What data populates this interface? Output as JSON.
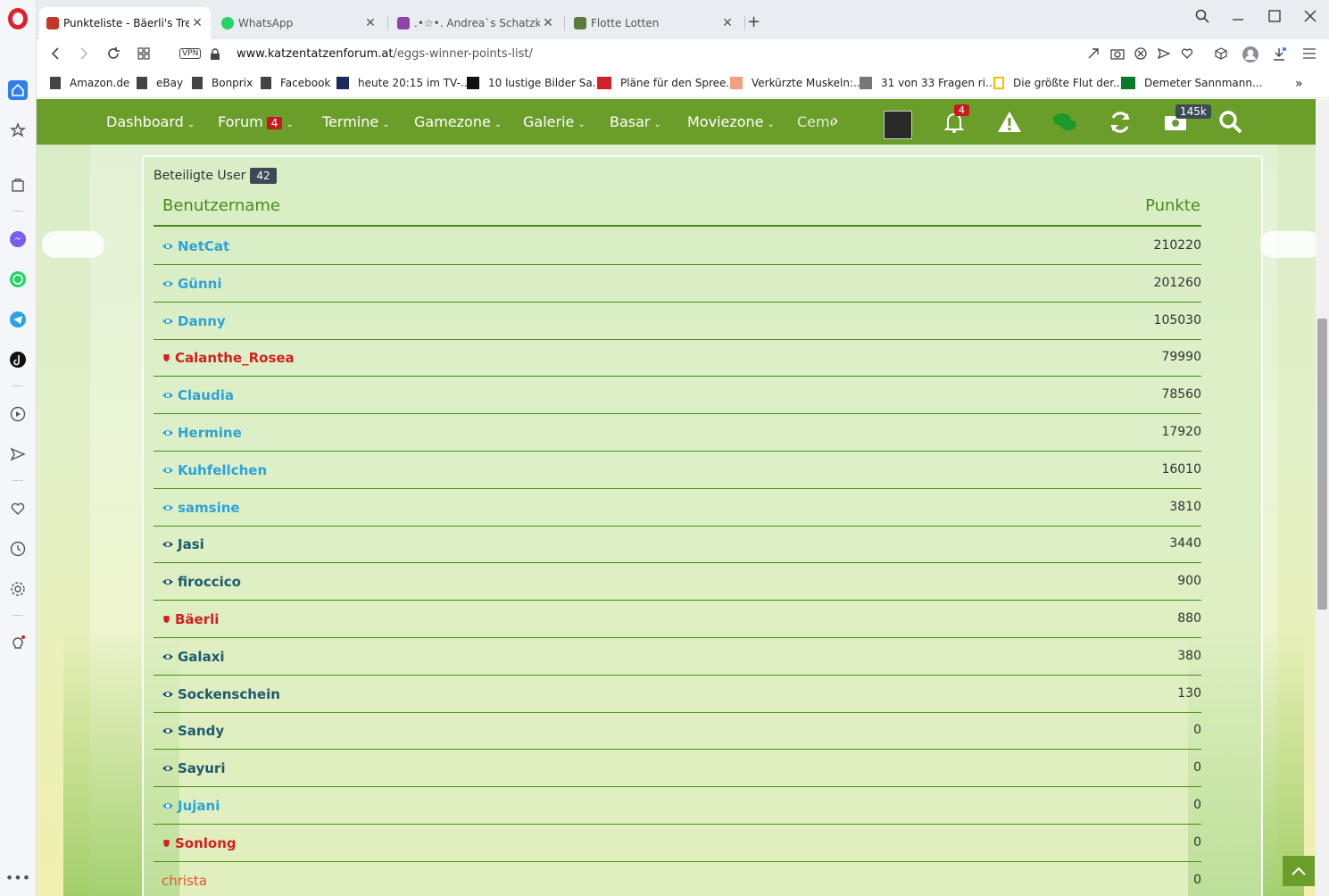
{
  "browser": {
    "tabs": [
      {
        "title": "Punkteliste - Bäerli's Treff fü",
        "active": true,
        "favicon_color": "#c0392b"
      },
      {
        "title": "WhatsApp",
        "active": false,
        "favicon_color": "#25d366"
      },
      {
        "title": ".•☆•. Andrea`s Schatzkästch",
        "active": false,
        "favicon_color": "#8e44ad"
      },
      {
        "title": "Flotte Lotten",
        "active": false,
        "favicon_color": "#5d7a3a"
      }
    ],
    "tab_close": "✕",
    "new_tab": "+",
    "url_domain": "www.katzentatzenforum.at",
    "url_path": "/eggs-winner-points-list/",
    "vpn_label": "VPN",
    "bookmarks": [
      "Amazon.de",
      "eBay",
      "Bonprix",
      "Facebook",
      "heute 20:15 im TV-...",
      "10 lustige Bilder Sa...",
      "Pläne für den Spree...",
      "Verkürzte Muskeln:...",
      "31 von 33 Fragen ri...",
      "Die größte Flut der...",
      "Demeter Sannmann..."
    ]
  },
  "site_nav": {
    "items": [
      "Dashboard",
      "Forum",
      "Termine",
      "Gamezone",
      "Galerie",
      "Basar",
      "Moviezone",
      "Ceme"
    ],
    "forum_badge": "4",
    "bell_badge": "4",
    "coin_badge": "145k"
  },
  "panel": {
    "title": "Beteiligte User",
    "count": "42",
    "col_user": "Benutzername",
    "col_points": "Punkte",
    "rows": [
      {
        "name": "NetCat",
        "points": "210220",
        "role": "eye-light"
      },
      {
        "name": "Günni",
        "points": "201260",
        "role": "eye-light"
      },
      {
        "name": "Danny",
        "points": "105030",
        "role": "eye-light"
      },
      {
        "name": "Calanthe_Rosea",
        "points": "79990",
        "role": "shield"
      },
      {
        "name": "Claudia",
        "points": "78560",
        "role": "eye-light"
      },
      {
        "name": "Hermine",
        "points": "17920",
        "role": "eye-light"
      },
      {
        "name": "Kuhfellchen",
        "points": "16010",
        "role": "eye-light"
      },
      {
        "name": "samsine",
        "points": "3810",
        "role": "eye-light"
      },
      {
        "name": "Jasi",
        "points": "3440",
        "role": "eye-dark"
      },
      {
        "name": "firoccico",
        "points": "900",
        "role": "eye-dark"
      },
      {
        "name": "Bäerli",
        "points": "880",
        "role": "shield"
      },
      {
        "name": "Galaxi",
        "points": "380",
        "role": "eye-dark"
      },
      {
        "name": "Sockenschein",
        "points": "130",
        "role": "eye-dark"
      },
      {
        "name": "Sandy",
        "points": "0",
        "role": "eye-dark"
      },
      {
        "name": "Sayuri",
        "points": "0",
        "role": "eye-dark"
      },
      {
        "name": "Jujani",
        "points": "0",
        "role": "eye-light"
      },
      {
        "name": "Sonlong",
        "points": "0",
        "role": "shield"
      },
      {
        "name": "christa",
        "points": "0",
        "role": "plain"
      }
    ]
  },
  "colors": {
    "nav_green": "#6b9d2b",
    "header_green": "#4a8a1a",
    "user_light": "#2fa3d6",
    "user_dark": "#1f5a6e",
    "user_admin": "#d21f1f",
    "user_plain": "#e0552a"
  }
}
